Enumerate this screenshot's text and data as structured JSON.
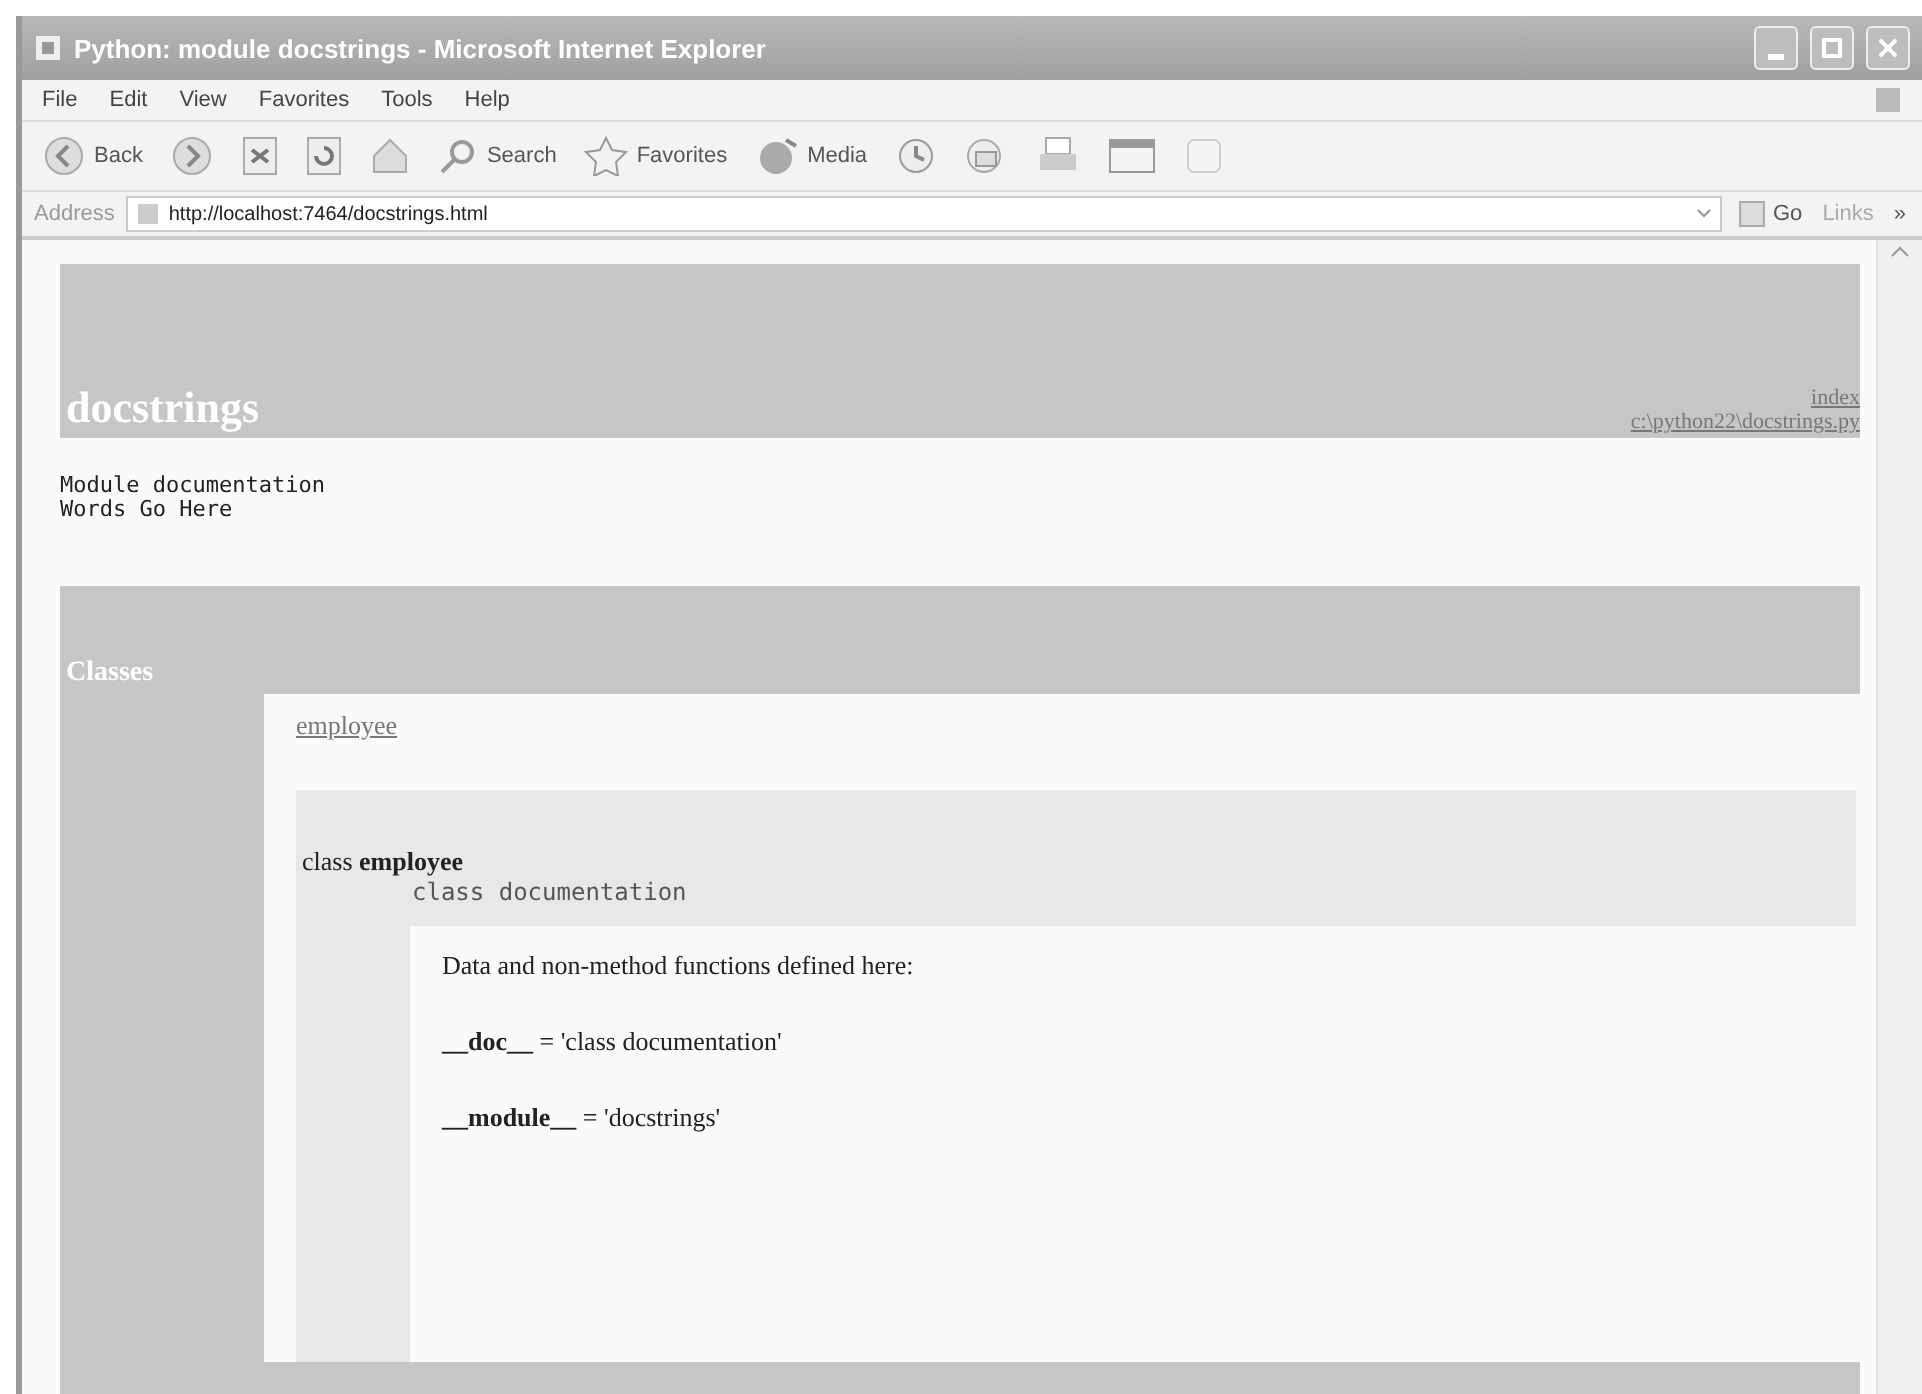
{
  "window": {
    "title": "Python: module docstrings - Microsoft Internet Explorer"
  },
  "menu": [
    "File",
    "Edit",
    "View",
    "Favorites",
    "Tools",
    "Help"
  ],
  "toolbar": [
    {
      "kind": "back",
      "label": "Back"
    },
    {
      "kind": "forward"
    },
    {
      "kind": "stop"
    },
    {
      "kind": "refresh"
    },
    {
      "kind": "home"
    },
    {
      "kind": "search",
      "label": "Search"
    },
    {
      "kind": "favorites",
      "label": "Favorites"
    },
    {
      "kind": "media",
      "label": "Media"
    },
    {
      "kind": "history"
    },
    {
      "kind": "mail"
    },
    {
      "kind": "print"
    },
    {
      "kind": "edit"
    },
    {
      "kind": "discuss"
    }
  ],
  "address": {
    "label": "Address",
    "value": "http://localhost:7464/docstrings.html",
    "go": "Go",
    "links": "Links",
    "more": "»"
  },
  "page": {
    "heading": "docstrings",
    "heading_links": [
      "index",
      "c:\\python22\\docstrings.py"
    ],
    "module_doc": [
      "Module documentation",
      "Words Go Here"
    ],
    "section_title": "Classes",
    "class_links": [
      "employee"
    ],
    "class": {
      "prefix": "class",
      "name": "employee",
      "doc": "class documentation",
      "data_heading": "Data and non-method functions defined here:",
      "attributes": [
        {
          "name": "__doc__",
          "value": "= 'class documentation'"
        },
        {
          "name": "__module__",
          "value": "= 'docstrings'"
        }
      ]
    }
  }
}
